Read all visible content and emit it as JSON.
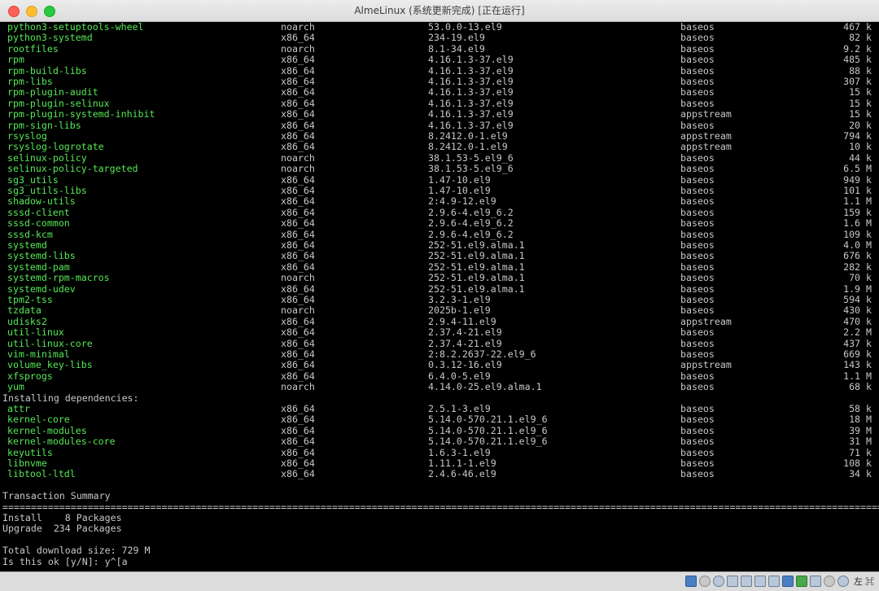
{
  "window": {
    "title": "AlmeLinux (系统更新完成) [正在运行]"
  },
  "packages": [
    [
      "python3-setuptools-wheel",
      "noarch",
      "53.0.0-13.el9",
      "baseos",
      "467 k"
    ],
    [
      "python3-systemd",
      "x86_64",
      "234-19.el9",
      "baseos",
      "82 k"
    ],
    [
      "rootfiles",
      "noarch",
      "8.1-34.el9",
      "baseos",
      "9.2 k"
    ],
    [
      "rpm",
      "x86_64",
      "4.16.1.3-37.el9",
      "baseos",
      "485 k"
    ],
    [
      "rpm-build-libs",
      "x86_64",
      "4.16.1.3-37.el9",
      "baseos",
      "88 k"
    ],
    [
      "rpm-libs",
      "x86_64",
      "4.16.1.3-37.el9",
      "baseos",
      "307 k"
    ],
    [
      "rpm-plugin-audit",
      "x86_64",
      "4.16.1.3-37.el9",
      "baseos",
      "15 k"
    ],
    [
      "rpm-plugin-selinux",
      "x86_64",
      "4.16.1.3-37.el9",
      "baseos",
      "15 k"
    ],
    [
      "rpm-plugin-systemd-inhibit",
      "x86_64",
      "4.16.1.3-37.el9",
      "appstream",
      "15 k"
    ],
    [
      "rpm-sign-libs",
      "x86_64",
      "4.16.1.3-37.el9",
      "baseos",
      "20 k"
    ],
    [
      "rsyslog",
      "x86_64",
      "8.2412.0-1.el9",
      "appstream",
      "794 k"
    ],
    [
      "rsyslog-logrotate",
      "x86_64",
      "8.2412.0-1.el9",
      "appstream",
      "10 k"
    ],
    [
      "selinux-policy",
      "noarch",
      "38.1.53-5.el9_6",
      "baseos",
      "44 k"
    ],
    [
      "selinux-policy-targeted",
      "noarch",
      "38.1.53-5.el9_6",
      "baseos",
      "6.5 M"
    ],
    [
      "sg3_utils",
      "x86_64",
      "1.47-10.el9",
      "baseos",
      "949 k"
    ],
    [
      "sg3_utils-libs",
      "x86_64",
      "1.47-10.el9",
      "baseos",
      "101 k"
    ],
    [
      "shadow-utils",
      "x86_64",
      "2:4.9-12.el9",
      "baseos",
      "1.1 M"
    ],
    [
      "sssd-client",
      "x86_64",
      "2.9.6-4.el9_6.2",
      "baseos",
      "159 k"
    ],
    [
      "sssd-common",
      "x86_64",
      "2.9.6-4.el9_6.2",
      "baseos",
      "1.6 M"
    ],
    [
      "sssd-kcm",
      "x86_64",
      "2.9.6-4.el9_6.2",
      "baseos",
      "109 k"
    ],
    [
      "systemd",
      "x86_64",
      "252-51.el9.alma.1",
      "baseos",
      "4.0 M"
    ],
    [
      "systemd-libs",
      "x86_64",
      "252-51.el9.alma.1",
      "baseos",
      "676 k"
    ],
    [
      "systemd-pam",
      "x86_64",
      "252-51.el9.alma.1",
      "baseos",
      "282 k"
    ],
    [
      "systemd-rpm-macros",
      "noarch",
      "252-51.el9.alma.1",
      "baseos",
      "70 k"
    ],
    [
      "systemd-udev",
      "x86_64",
      "252-51.el9.alma.1",
      "baseos",
      "1.9 M"
    ],
    [
      "tpm2-tss",
      "x86_64",
      "3.2.3-1.el9",
      "baseos",
      "594 k"
    ],
    [
      "tzdata",
      "noarch",
      "2025b-1.el9",
      "baseos",
      "430 k"
    ],
    [
      "udisks2",
      "x86_64",
      "2.9.4-11.el9",
      "appstream",
      "470 k"
    ],
    [
      "util-linux",
      "x86_64",
      "2.37.4-21.el9",
      "baseos",
      "2.2 M"
    ],
    [
      "util-linux-core",
      "x86_64",
      "2.37.4-21.el9",
      "baseos",
      "437 k"
    ],
    [
      "vim-minimal",
      "x86_64",
      "2:8.2.2637-22.el9_6",
      "baseos",
      "669 k"
    ],
    [
      "volume_key-libs",
      "x86_64",
      "0.3.12-16.el9",
      "appstream",
      "143 k"
    ],
    [
      "xfsprogs",
      "x86_64",
      "6.4.0-5.el9",
      "baseos",
      "1.1 M"
    ],
    [
      "yum",
      "noarch",
      "4.14.0-25.el9.alma.1",
      "baseos",
      "68 k"
    ]
  ],
  "deps_header": "Installing dependencies:",
  "dependencies": [
    [
      "attr",
      "x86_64",
      "2.5.1-3.el9",
      "baseos",
      "58 k"
    ],
    [
      "kernel-core",
      "x86_64",
      "5.14.0-570.21.1.el9_6",
      "baseos",
      "18 M"
    ],
    [
      "kernel-modules",
      "x86_64",
      "5.14.0-570.21.1.el9_6",
      "baseos",
      "39 M"
    ],
    [
      "kernel-modules-core",
      "x86_64",
      "5.14.0-570.21.1.el9_6",
      "baseos",
      "31 M"
    ],
    [
      "keyutils",
      "x86_64",
      "1.6.3-1.el9",
      "baseos",
      "71 k"
    ],
    [
      "libnvme",
      "x86_64",
      "1.11.1-1.el9",
      "baseos",
      "108 k"
    ],
    [
      "libtool-ltdl",
      "x86_64",
      "2.4.6-46.el9",
      "baseos",
      "34 k"
    ]
  ],
  "summary": {
    "title": "Transaction Summary",
    "separator": "================================================================================================================================================================",
    "install": "Install    8 Packages",
    "upgrade": "Upgrade  234 Packages",
    "download": "Total download size: 729 M",
    "prompt": "Is this ok [y/N]: y^[a"
  },
  "statusbar": {
    "host_key": "左 ⌘"
  }
}
